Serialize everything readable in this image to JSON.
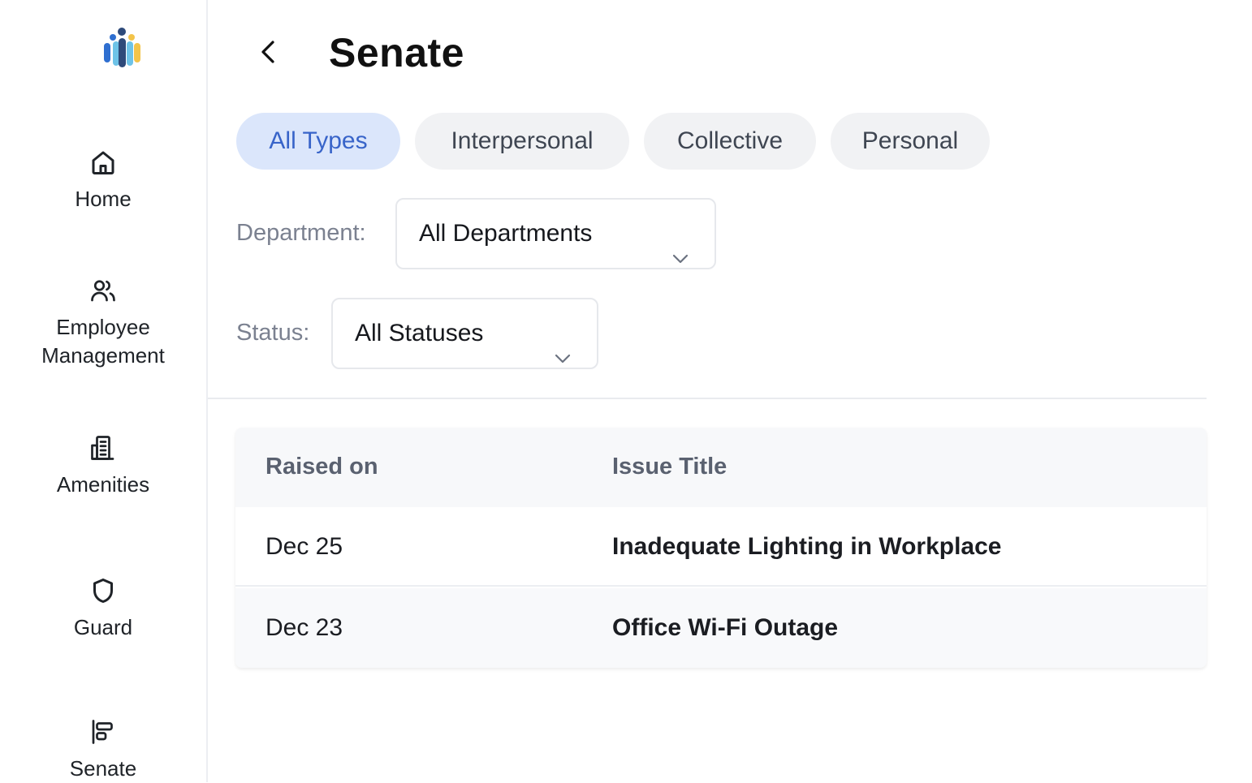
{
  "sidebar": {
    "items": [
      {
        "label": "Home",
        "icon": "home-icon"
      },
      {
        "label_line1": "Employee",
        "label_line2": "Management",
        "icon": "users-icon"
      },
      {
        "label": "Amenities",
        "icon": "building-icon"
      },
      {
        "label": "Guard",
        "icon": "shield-icon"
      },
      {
        "label": "Senate",
        "icon": "align-left-icon"
      }
    ]
  },
  "header": {
    "title": "Senate",
    "back_icon": "chevron-left-icon"
  },
  "filters": {
    "type_tabs": [
      {
        "label": "All Types",
        "active": true
      },
      {
        "label": "Interpersonal",
        "active": false
      },
      {
        "label": "Collective",
        "active": false
      },
      {
        "label": "Personal",
        "active": false
      }
    ],
    "department": {
      "label": "Department:",
      "value": "All Departments"
    },
    "status": {
      "label": "Status:",
      "value": "All Statuses"
    }
  },
  "table": {
    "columns": [
      "Raised on",
      "Issue Title"
    ],
    "rows": [
      {
        "raised_on": "Dec 25",
        "issue_title": "Inadequate Lighting in Workplace"
      },
      {
        "raised_on": "Dec 23",
        "issue_title": "Office Wi-Fi Outage"
      }
    ]
  },
  "colors": {
    "accent": "#3864c9",
    "accent_bg": "#dbe6fb",
    "logo_blue": "#2f6fd0",
    "logo_teal": "#6ec3e8",
    "logo_yellow": "#f3c44a",
    "logo_navy": "#2e4a7a"
  }
}
